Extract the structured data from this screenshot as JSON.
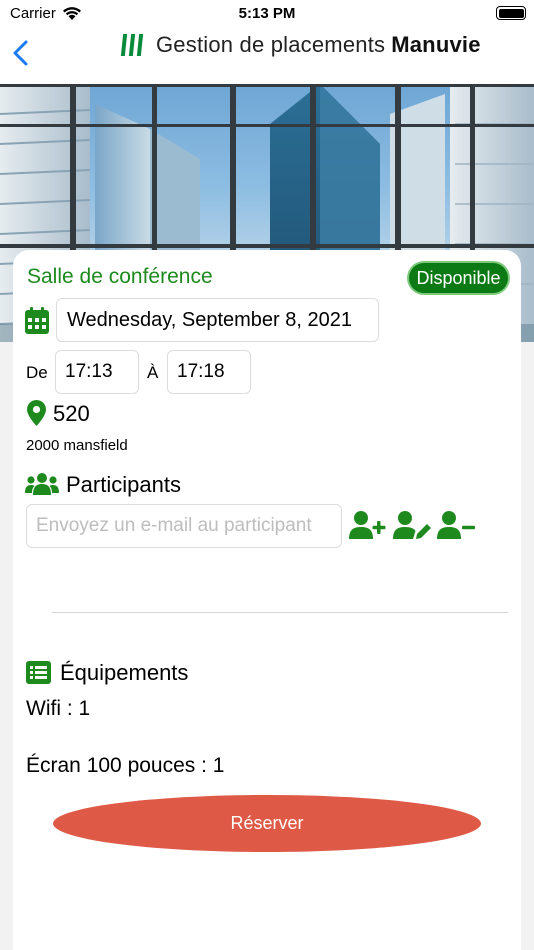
{
  "status_bar": {
    "carrier": "Carrier",
    "time": "5:13 PM"
  },
  "nav": {
    "back_icon": "chevron-left-icon",
    "logo_text": "Gestion de placements",
    "logo_brand": "Manuvie"
  },
  "room": {
    "title": "Salle de conférence",
    "status": "Disponible",
    "date": "Wednesday, September 8, 2021",
    "from_label": "De",
    "from_time": "17:13",
    "to_label": "À",
    "to_time": "17:18",
    "number": "520",
    "address": "2000 mansfield"
  },
  "participants": {
    "title": "Participants",
    "placeholder": "Envoyez un e-mail au participant"
  },
  "equipment": {
    "title": "Équipements",
    "items": [
      {
        "label": "Wifi : 1"
      },
      {
        "label": "Écran 100 pouces : 1"
      }
    ]
  },
  "actions": {
    "reserve_label": "Réserver"
  },
  "colors": {
    "green": "#1e8a1e",
    "badge": "#0b7a14",
    "reserve": "#de5a47",
    "back": "#1a7cf5"
  }
}
